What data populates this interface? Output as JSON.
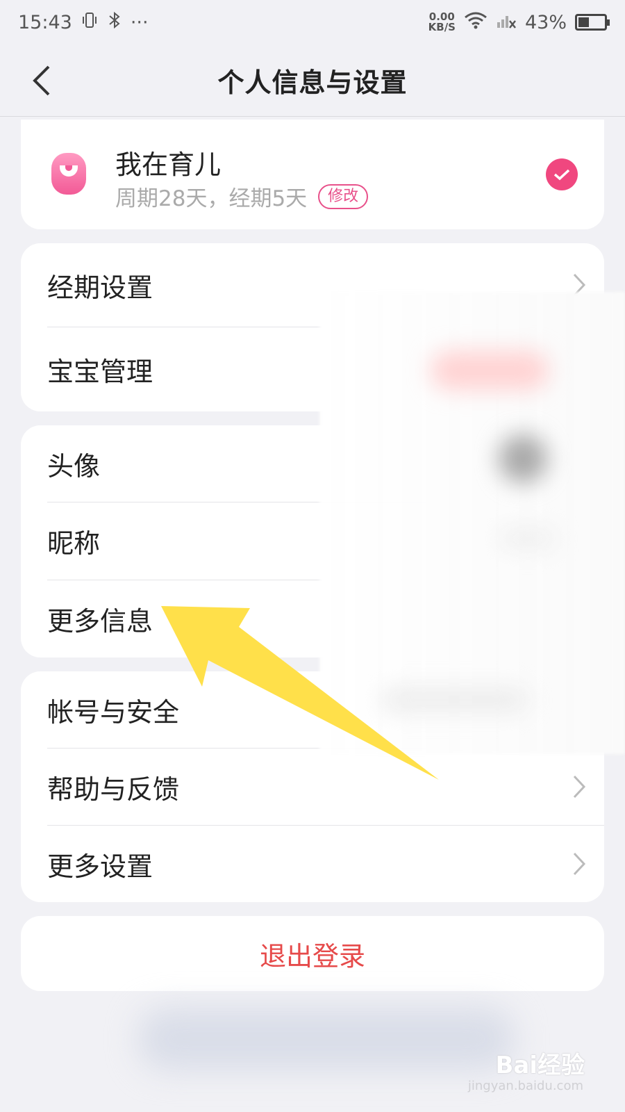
{
  "status_bar": {
    "time": "15:43",
    "more_dots": "···",
    "net_speed_value": "0.00",
    "net_speed_unit": "KB/S",
    "battery_percent": "43%",
    "battery_level": 0.43
  },
  "header": {
    "title": "个人信息与设置"
  },
  "mode_card": {
    "title": "我在育儿",
    "subtitle": "周期28天，经期5天",
    "edit_label": "修改",
    "accent_color": "#f0477f"
  },
  "group1": {
    "items": [
      {
        "label": "经期设置"
      },
      {
        "label": "宝宝管理"
      }
    ]
  },
  "group2": {
    "items": [
      {
        "label": "头像"
      },
      {
        "label": "昵称"
      },
      {
        "label": "更多信息"
      }
    ]
  },
  "group3": {
    "items": [
      {
        "label": "帐号与安全"
      },
      {
        "label": "帮助与反馈"
      },
      {
        "label": "更多设置"
      }
    ]
  },
  "logout": {
    "label": "退出登录",
    "color": "#e64a4a"
  },
  "watermark": {
    "brand": "Bai经验",
    "url": "jingyan.baidu.com"
  },
  "annotation": {
    "arrow_color": "#ffe04a"
  }
}
